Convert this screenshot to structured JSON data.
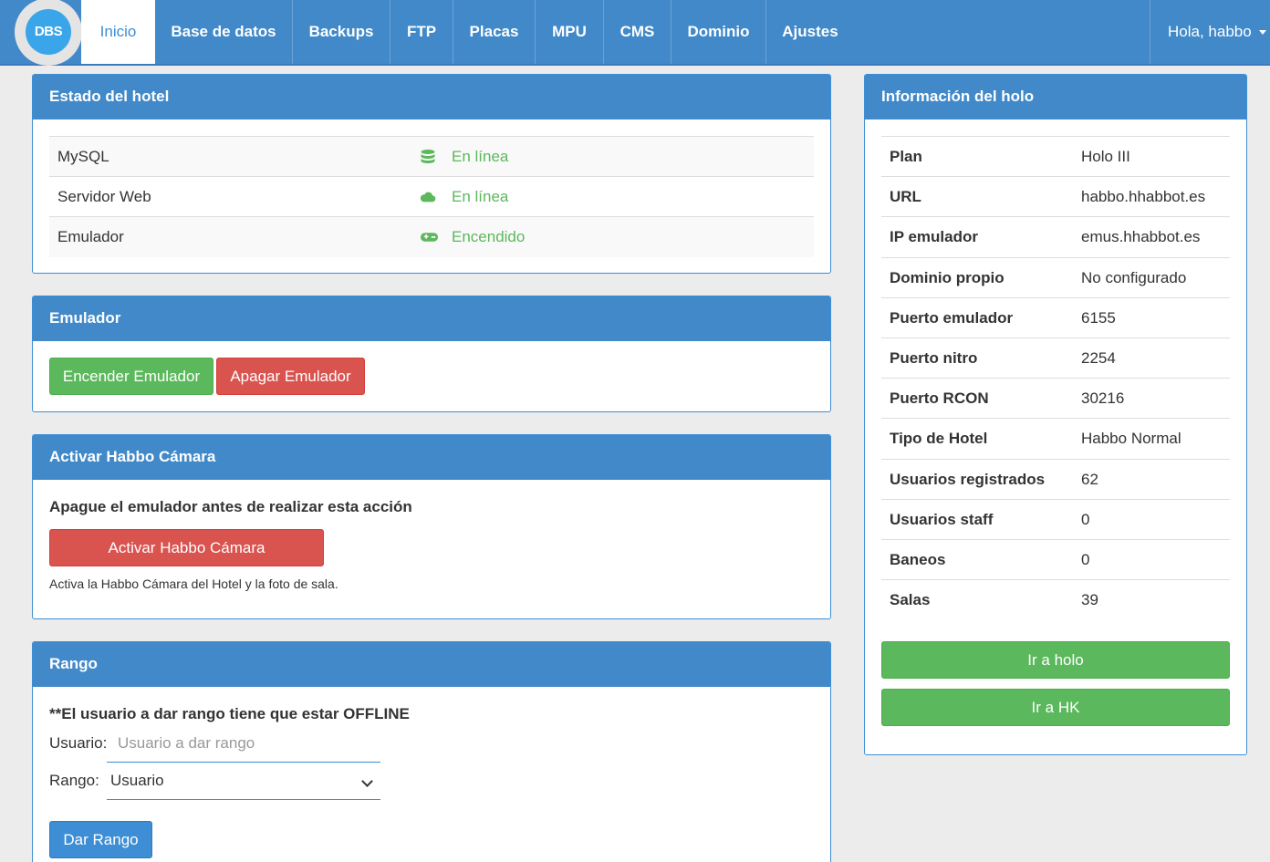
{
  "nav": {
    "logo_text": "DBS",
    "items": [
      {
        "label": "Inicio"
      },
      {
        "label": "Base de datos"
      },
      {
        "label": "Backups"
      },
      {
        "label": "FTP"
      },
      {
        "label": "Placas"
      },
      {
        "label": "MPU"
      },
      {
        "label": "CMS"
      },
      {
        "label": "Dominio"
      },
      {
        "label": "Ajustes"
      }
    ],
    "user_label": "Hola, habbo"
  },
  "hotel_status": {
    "title": "Estado del hotel",
    "rows": [
      {
        "label": "MySQL",
        "icon": "database-icon",
        "value": "En línea"
      },
      {
        "label": "Servidor Web",
        "icon": "cloud-icon",
        "value": "En línea"
      },
      {
        "label": "Emulador",
        "icon": "gamepad-icon",
        "value": "Encendido"
      }
    ]
  },
  "emulator": {
    "title": "Emulador",
    "start_label": "Encender Emulador",
    "stop_label": "Apagar Emulador"
  },
  "camera": {
    "title": "Activar Habbo Cámara",
    "warning": "Apague el emulador antes de realizar esta acción",
    "button_label": "Activar Habbo Cámara",
    "description": "Activa la Habbo Cámara del Hotel y la foto de sala."
  },
  "rank": {
    "title": "Rango",
    "notice": "**El usuario a dar rango tiene que estar OFFLINE",
    "user_label": "Usuario:",
    "user_placeholder": "Usuario a dar rango",
    "rank_label": "Rango:",
    "rank_selected": "Usuario",
    "button_label": "Dar Rango"
  },
  "holo_info": {
    "title": "Información del holo",
    "rows": [
      {
        "key": "Plan",
        "value": "Holo III"
      },
      {
        "key": "URL",
        "value": "habbo.hhabbot.es"
      },
      {
        "key": "IP emulador",
        "value": "emus.hhabbot.es"
      },
      {
        "key": "Dominio propio",
        "value": "No configurado"
      },
      {
        "key": "Puerto emulador",
        "value": "6155"
      },
      {
        "key": "Puerto nitro",
        "value": "2254"
      },
      {
        "key": "Puerto RCON",
        "value": "30216"
      },
      {
        "key": "Tipo de Hotel",
        "value": "Habbo Normal"
      },
      {
        "key": "Usuarios registrados",
        "value": "62"
      },
      {
        "key": "Usuarios staff",
        "value": "0"
      },
      {
        "key": "Baneos",
        "value": "0"
      },
      {
        "key": "Salas",
        "value": "39"
      }
    ],
    "go_holo_label": "Ir a holo",
    "go_hk_label": "Ir a HK"
  },
  "colors": {
    "primary": "#4189c9",
    "success": "#5cb85c",
    "danger": "#d9534f",
    "background": "#ececec"
  }
}
